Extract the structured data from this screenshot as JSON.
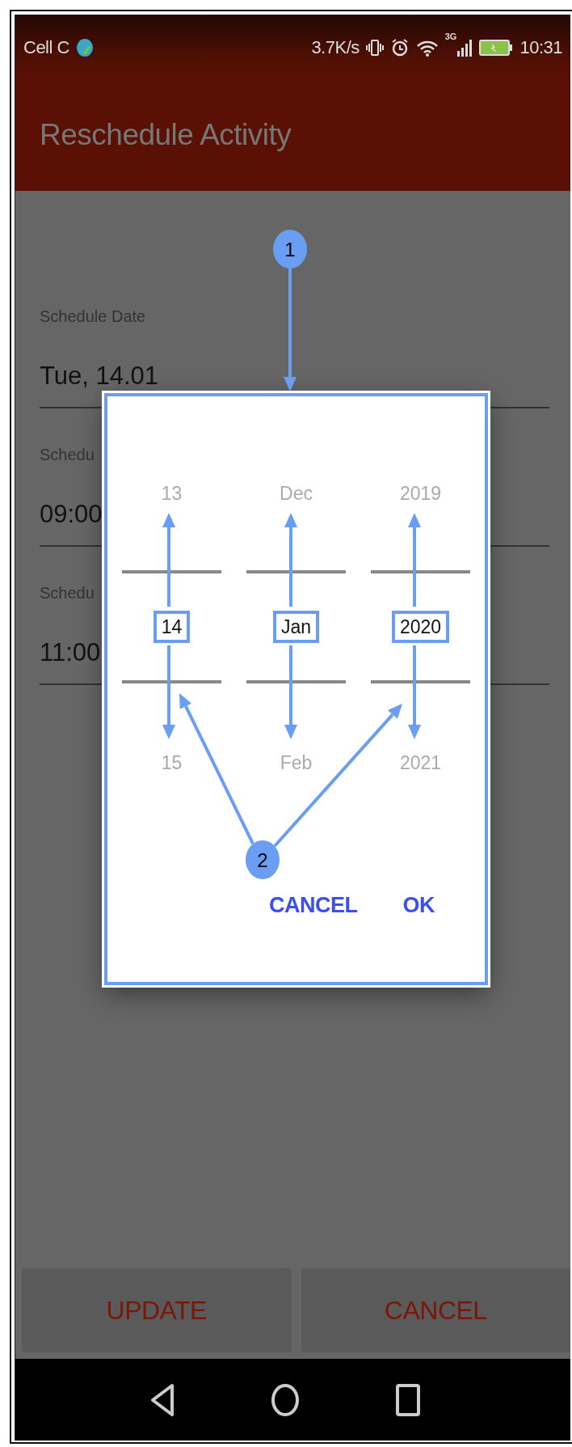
{
  "status_bar": {
    "carrier": "Cell C",
    "speed": "3.7K/s",
    "network": "3G",
    "time": "10:31"
  },
  "app_bar": {
    "title": "Reschedule Activity"
  },
  "fields": [
    {
      "label": "Schedule Date",
      "value": "Tue, 14.01"
    },
    {
      "label": "Schedu",
      "value": "09:00"
    },
    {
      "label": "Schedu",
      "value": "11:00"
    }
  ],
  "date_picker": {
    "columns": [
      {
        "previous": "13",
        "current": "14",
        "next": "15"
      },
      {
        "previous": "Dec",
        "current": "Jan",
        "next": "Feb"
      },
      {
        "previous": "2019",
        "current": "2020",
        "next": "2021"
      }
    ],
    "buttons": [
      "CANCEL",
      "OK"
    ]
  },
  "buttons": [
    "UPDATE",
    "CANCEL"
  ],
  "annotations": [
    {
      "label": "1"
    },
    {
      "label": "2"
    }
  ]
}
